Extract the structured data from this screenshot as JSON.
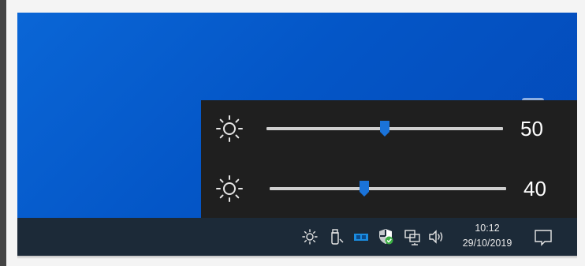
{
  "flyout": {
    "sliders": [
      {
        "icon": "sun-icon",
        "value": 50,
        "label": "50",
        "level": 0.5
      },
      {
        "icon": "sun-icon",
        "value": 40,
        "label": "40",
        "level": 0.4
      }
    ]
  },
  "taskbar": {
    "tray_icons": [
      "brightness-icon",
      "usb-drive-icon",
      "app-tray-icon",
      "windows-security-icon",
      "network-icon",
      "volume-icon"
    ],
    "clock": {
      "time": "10:12",
      "date": "29/10/2019"
    },
    "notification_icon": "action-center-icon"
  },
  "colors": {
    "desktop_blue": "#0456c7",
    "flyout_bg": "#1f1f1f",
    "taskbar_bg": "#1c2a38",
    "accent": "#1a73d9",
    "security_green": "#3cb043"
  }
}
